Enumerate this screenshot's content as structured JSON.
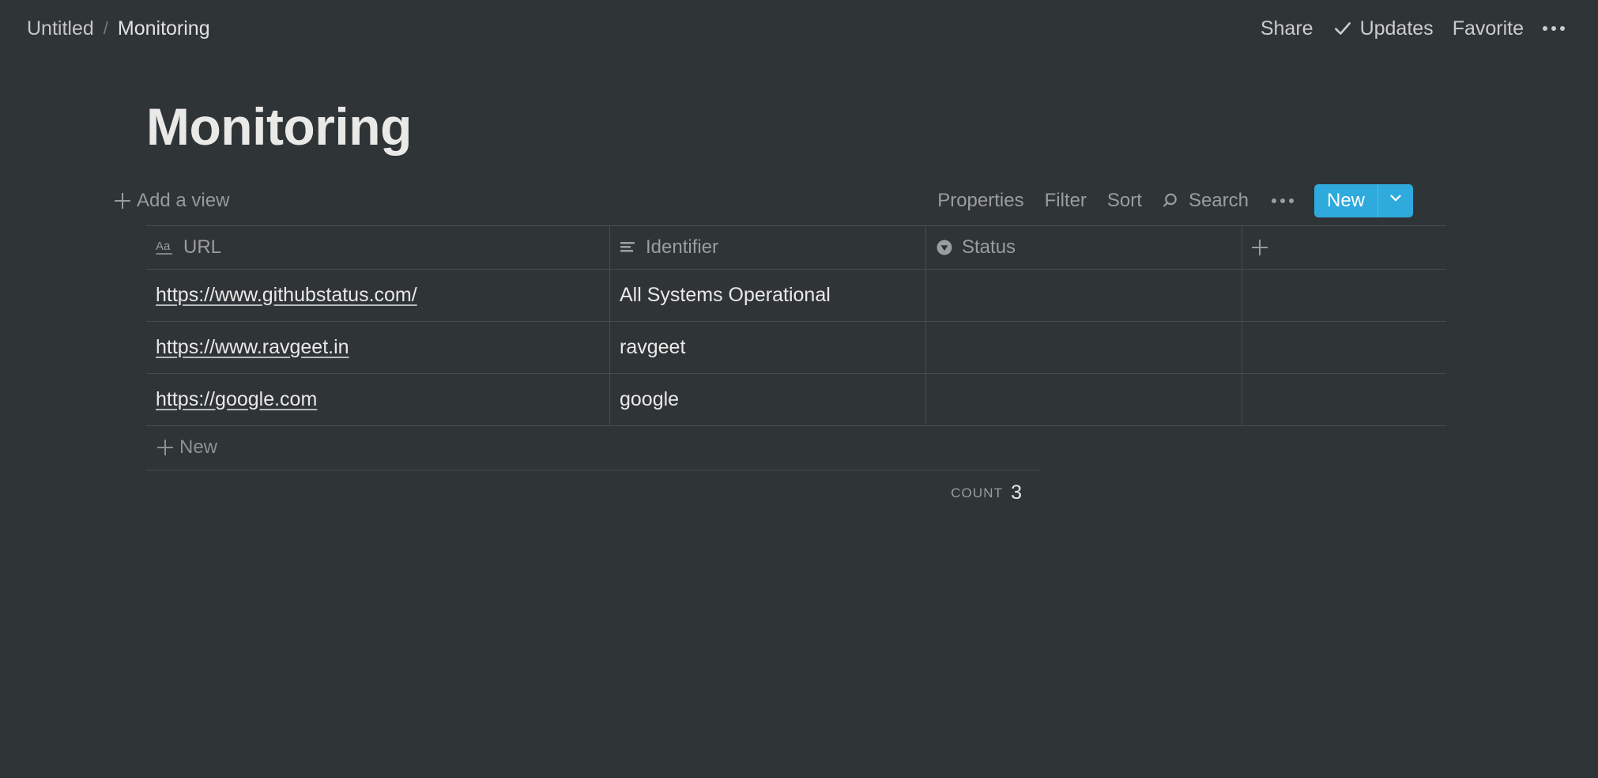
{
  "topbar": {
    "breadcrumb": {
      "parent": "Untitled",
      "separator": "/",
      "current": "Monitoring"
    },
    "share_label": "Share",
    "updates_label": "Updates",
    "favorite_label": "Favorite",
    "more_icon": "ellipsis-icon",
    "updates_icon": "check-icon"
  },
  "page": {
    "title": "Monitoring"
  },
  "toolbar": {
    "add_view_label": "Add a view",
    "add_view_icon": "plus-icon",
    "properties_label": "Properties",
    "filter_label": "Filter",
    "sort_label": "Sort",
    "search_label": "Search",
    "search_icon": "search-icon",
    "more_icon": "ellipsis-icon",
    "new_label": "New",
    "new_caret_icon": "chevron-down-icon",
    "accent_color": "#2eaadc"
  },
  "table": {
    "columns": [
      {
        "label": "URL",
        "type_icon": "title-text-icon"
      },
      {
        "label": "Identifier",
        "type_icon": "text-lines-icon"
      },
      {
        "label": "Status",
        "type_icon": "select-icon"
      }
    ],
    "add_column_icon": "plus-icon",
    "rows": [
      {
        "url": "https://www.githubstatus.com/",
        "identifier": "All Systems Operational",
        "status": ""
      },
      {
        "url": "https://www.ravgeet.in",
        "identifier": "ravgeet",
        "status": ""
      },
      {
        "url": "https://google.com",
        "identifier": "google",
        "status": ""
      }
    ],
    "new_row_label": "New",
    "new_row_icon": "plus-icon",
    "count_label": "COUNT",
    "count_value": "3"
  }
}
